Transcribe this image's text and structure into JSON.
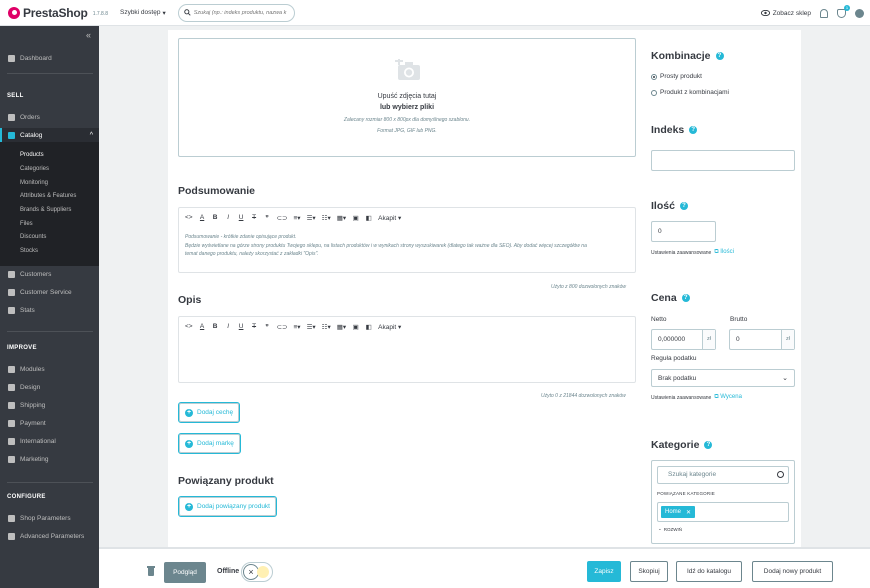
{
  "header": {
    "logo_text": "PrestaShop",
    "version": "1.7.8.8",
    "quick_access": "Szybki dostęp",
    "search_placeholder": "Szukaj (np.: indeks produktu, nazwa k",
    "view_shop": "Zobacz sklep",
    "notifications_count": "1"
  },
  "sidebar": {
    "dashboard": "Dashboard",
    "sell_title": "SELL",
    "orders": "Orders",
    "catalog": "Catalog",
    "catalog_sub": [
      "Products",
      "Categories",
      "Monitoring",
      "Attributes & Features",
      "Brands & Suppliers",
      "Files",
      "Discounts",
      "Stocks"
    ],
    "customers": "Customers",
    "customer_service": "Customer Service",
    "stats": "Stats",
    "improve_title": "IMPROVE",
    "modules": "Modules",
    "design": "Design",
    "shipping": "Shipping",
    "payment": "Payment",
    "international": "International",
    "marketing": "Marketing",
    "configure_title": "CONFIGURE",
    "shop_parameters": "Shop Parameters",
    "advanced_parameters": "Advanced Parameters"
  },
  "dropzone": {
    "title": "Upuść zdjęcia tutaj",
    "link": "lub wybierz pliki",
    "hint1": "Zalecany rozmiar 800 x 800px dla domyślnego szablonu.",
    "hint2": "Format JPG, GIF lub PNG."
  },
  "summary": {
    "title": "Podsumowanie",
    "paragraph_label": "Akapit",
    "text1": "Podsumowanie - krótkie zdanie opisujące produkt.",
    "text2": "Będzie wyświetlane na górze strony produktu Twojego sklepu, na listach produktów i w wynikach strony wyszukiwarek (dlatego tak ważne dla SEO). Aby dodać więcej szczegółów na",
    "text3": "temat danego produktu, należy skorzystać z zakładki \"Opis\".",
    "counter": "Użyto z 800 dozwolonych znaków"
  },
  "description": {
    "title": "Opis",
    "paragraph_label": "Akapit",
    "counter": "Użyto 0 z 21844 dozwolonych znaków"
  },
  "buttons": {
    "add_feature": "Dodaj cechę",
    "add_brand": "Dodaj markę",
    "add_related": "Dodaj powiązany produkt"
  },
  "related": {
    "title": "Powiązany produkt"
  },
  "right": {
    "combinations_title": "Kombinacje",
    "simple_product": "Prosty produkt",
    "product_with_combinations": "Produkt z kombinacjami",
    "reference_title": "Indeks",
    "reference_value": "",
    "quantity_title": "Ilość",
    "quantity_value": "0",
    "advanced_settings": "Ustawienia zaawansowane",
    "quantities_link": "Ilości",
    "price_title": "Cena",
    "net_label": "Netto",
    "gross_label": "Brutto",
    "net_value": "0,000000",
    "gross_value": "0",
    "currency": "zł",
    "tax_rule_label": "Reguła podatku",
    "tax_rule_value": "Brak podatku",
    "price_link": "Wycena",
    "categories_title": "Kategorie",
    "category_search_placeholder": "Szukaj kategorie",
    "related_categories": "POWIĄZANE KATEGORIE",
    "category_tag": "Home",
    "root": "ROZWIŃ"
  },
  "footer": {
    "preview": "Podgląd",
    "offline": "Offline",
    "save": "Zapisz",
    "duplicate": "Skopiuj",
    "go_to_catalog": "Idź do katalogu",
    "add_new": "Dodaj nowy produkt"
  },
  "colors": {
    "accent": "#25b9d7",
    "sidebar": "#363a41",
    "brand": "#df0067"
  }
}
